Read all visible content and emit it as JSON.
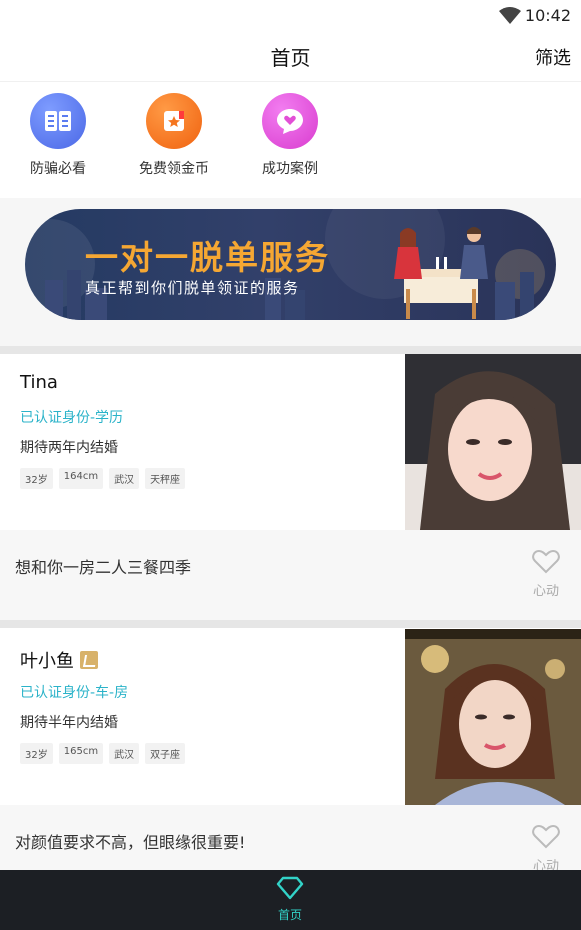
{
  "status_bar": {
    "time": "10:42"
  },
  "header": {
    "title": "首页",
    "filter_label": "筛选"
  },
  "quick_links": [
    {
      "label": "防骗必看",
      "icon": "book-icon",
      "color": "#5b7cf0"
    },
    {
      "label": "免费领金币",
      "icon": "gift-icon",
      "color": "#f5751f"
    },
    {
      "label": "成功案例",
      "icon": "heart-chat-icon",
      "color": "#e24fd6"
    }
  ],
  "banner": {
    "headline": "一对一脱单服务",
    "subtitle": "真正帮到你们脱单领证的服务"
  },
  "profiles": [
    {
      "name": "Tina",
      "vip": false,
      "verified": "已认证身份-学历",
      "expectation": "期待两年内结婚",
      "tags": [
        "32岁",
        "164cm",
        "武汉",
        "天秤座"
      ],
      "quote": "想和你一房二人三餐四季",
      "like_label": "心动"
    },
    {
      "name": "叶小鱼",
      "vip": true,
      "verified": "已认证身份-车-房",
      "expectation": "期待半年内结婚",
      "tags": [
        "32岁",
        "165cm",
        "武汉",
        "双子座"
      ],
      "quote": "对颜值要求不高，但眼缘很重要!",
      "like_label": "心动"
    }
  ],
  "bottom_nav": {
    "home_label": "首页"
  },
  "colors": {
    "accent": "#2bb3c9",
    "nav_active": "#32d3c8",
    "nav_bg": "#1c1f24",
    "banner_gold": "#f5a733"
  }
}
